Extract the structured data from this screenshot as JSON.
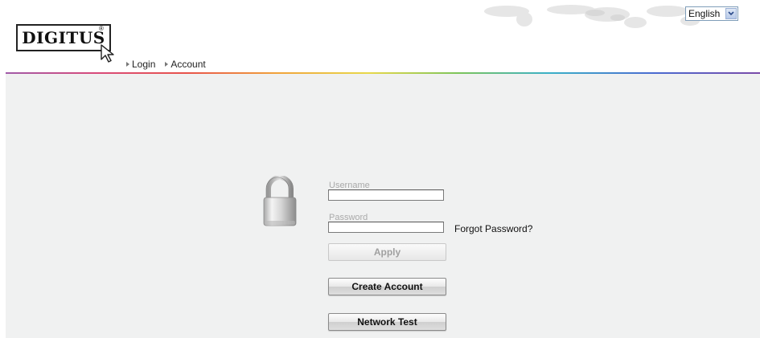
{
  "header": {
    "logo_text": "DIGITUS",
    "logo_reg": "®",
    "nav": [
      {
        "label": "Login"
      },
      {
        "label": "Account"
      }
    ],
    "language": {
      "selected": "English",
      "icon": "chevron-down-icon"
    }
  },
  "login_form": {
    "username_label": "Username",
    "username_value": "",
    "password_label": "Password",
    "password_value": "",
    "forgot_password": "Forgot Password?",
    "apply_label": "Apply",
    "create_account_label": "Create Account",
    "network_test_label": "Network Test",
    "lock_icon": "padlock-icon"
  },
  "colors": {
    "main_background": "#f0f1f1",
    "label_grey": "#aaaaaa",
    "select_border": "#7f9db9"
  }
}
